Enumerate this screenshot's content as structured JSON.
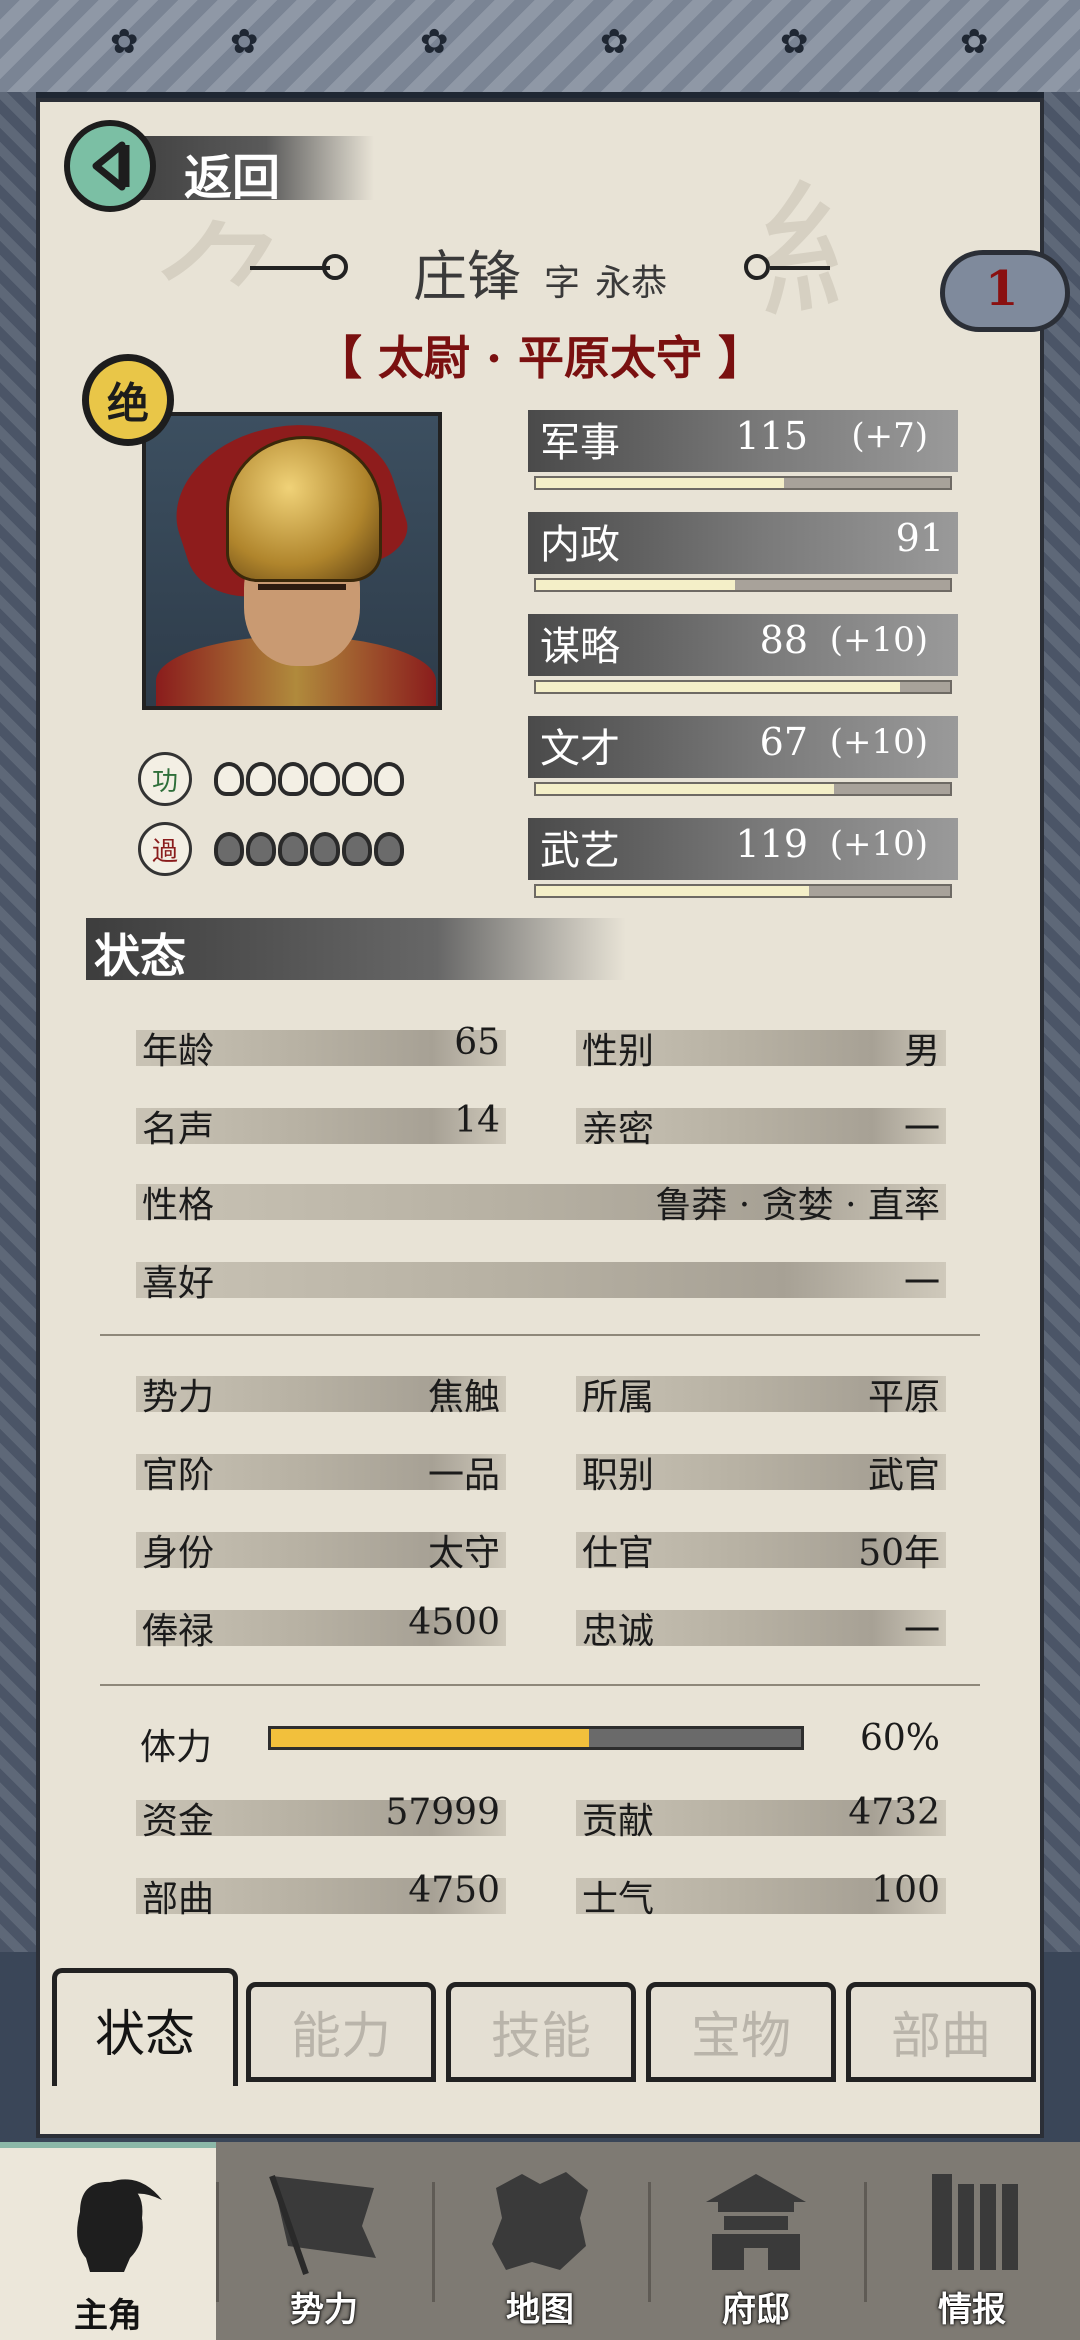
{
  "header": {
    "back_label": "返回"
  },
  "character": {
    "name": "庄锋",
    "courtesy_prefix": "字",
    "courtesy_name": "永恭",
    "title": "【 太尉 · 平原太守 】",
    "rank_badge": "绝",
    "badge_count": "1",
    "merit_label": "功",
    "fault_label": "過"
  },
  "stats": [
    {
      "label": "军事",
      "value": "115",
      "bonus": "(+7)",
      "level": 0.6
    },
    {
      "label": "内政",
      "value": "91",
      "bonus": "",
      "level": 0.48
    },
    {
      "label": "谋略",
      "value": "88",
      "bonus": "(+10)",
      "level": 0.88
    },
    {
      "label": "文才",
      "value": "67",
      "bonus": "(+10)",
      "level": 0.72
    },
    {
      "label": "武艺",
      "value": "119",
      "bonus": "(+10)",
      "level": 0.66
    }
  ],
  "status": {
    "header": "状态",
    "personal": [
      {
        "k": "年龄",
        "v": "65"
      },
      {
        "k": "性别",
        "v": "男"
      },
      {
        "k": "名声",
        "v": "14"
      },
      {
        "k": "亲密",
        "v": "一"
      },
      {
        "k": "性格",
        "v": "鲁莽 · 贪婪 · 直率"
      },
      {
        "k": "喜好",
        "v": "一"
      }
    ],
    "official": [
      {
        "k": "势力",
        "v": "焦触"
      },
      {
        "k": "所属",
        "v": "平原"
      },
      {
        "k": "官阶",
        "v": "一品"
      },
      {
        "k": "职别",
        "v": "武官"
      },
      {
        "k": "身份",
        "v": "太守"
      },
      {
        "k": "仕官",
        "v": "50年"
      },
      {
        "k": "俸禄",
        "v": "4500"
      },
      {
        "k": "忠诚",
        "v": "一"
      }
    ],
    "stamina": {
      "label": "体力",
      "value": "60%",
      "level": 0.6
    },
    "resources": [
      {
        "k": "资金",
        "v": "57999"
      },
      {
        "k": "贡献",
        "v": "4732"
      },
      {
        "k": "部曲",
        "v": "4750"
      },
      {
        "k": "士气",
        "v": "100"
      }
    ]
  },
  "tabs": [
    {
      "label": "状态",
      "active": true
    },
    {
      "label": "能力",
      "active": false
    },
    {
      "label": "技能",
      "active": false
    },
    {
      "label": "宝物",
      "active": false
    },
    {
      "label": "部曲",
      "active": false
    }
  ],
  "nav": [
    {
      "label": "主角",
      "icon": "hero-head-icon",
      "active": true
    },
    {
      "label": "势力",
      "icon": "flag-icon",
      "active": false
    },
    {
      "label": "地图",
      "icon": "map-icon",
      "active": false
    },
    {
      "label": "府邸",
      "icon": "mansion-icon",
      "active": false
    },
    {
      "label": "情报",
      "icon": "scroll-icon",
      "active": false
    }
  ],
  "colors": {
    "accent": "#7bbfa4",
    "title_red": "#7a1010",
    "stamina": "#f2c03c"
  }
}
